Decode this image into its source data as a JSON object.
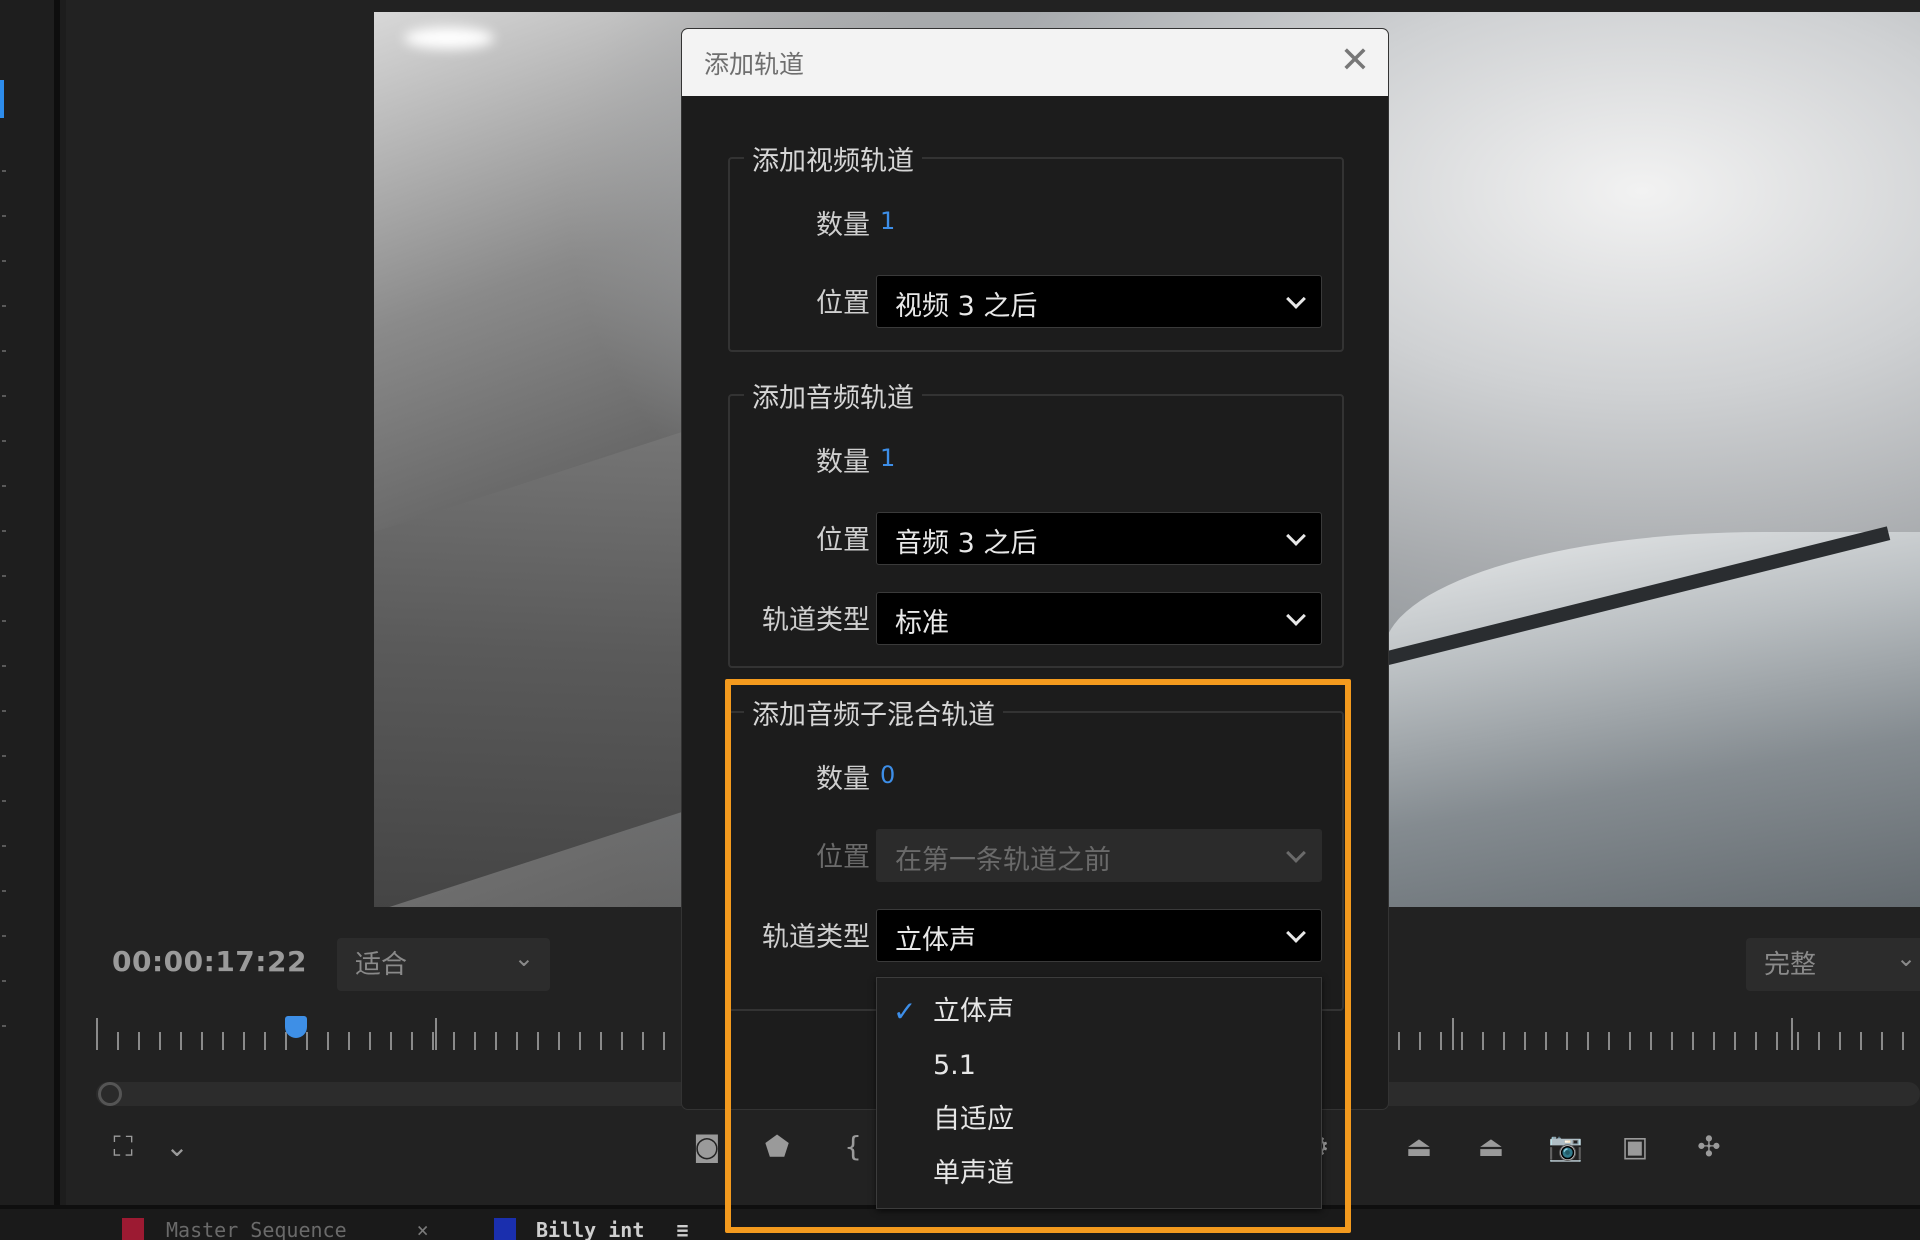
{
  "monitor": {
    "timecode": "00:00:17:22",
    "fit_select": "适合",
    "quality_select": "完整"
  },
  "tabs": [
    {
      "label": "Master Sequence",
      "close": "×"
    },
    {
      "label": "Billy int",
      "menu": "≡"
    }
  ],
  "dialog": {
    "title": "添加轨道",
    "close": "✕",
    "video_group": {
      "legend": "添加视频轨道",
      "count_label": "数量",
      "count_value": "1",
      "position_label": "位置",
      "position_value": "视频 3 之后"
    },
    "audio_group": {
      "legend": "添加音频轨道",
      "count_label": "数量",
      "count_value": "1",
      "position_label": "位置",
      "position_value": "音频 3 之后",
      "type_label": "轨道类型",
      "type_value": "标准"
    },
    "submix_group": {
      "legend": "添加音频子混合轨道",
      "count_label": "数量",
      "count_value": "0",
      "position_label": "位置",
      "position_value": "在第一条轨道之前",
      "type_label": "轨道类型",
      "type_value": "立体声"
    },
    "type_dropdown": {
      "options": [
        "立体声",
        "5.1",
        "自适应",
        "单声道"
      ],
      "selected": "立体声",
      "check": "✓"
    }
  },
  "colors": {
    "accent_blue": "#3d8ee8",
    "highlight_orange": "#f39a1e",
    "tab1_color": "#9c1a32",
    "tab2_color": "#1a2fae"
  }
}
